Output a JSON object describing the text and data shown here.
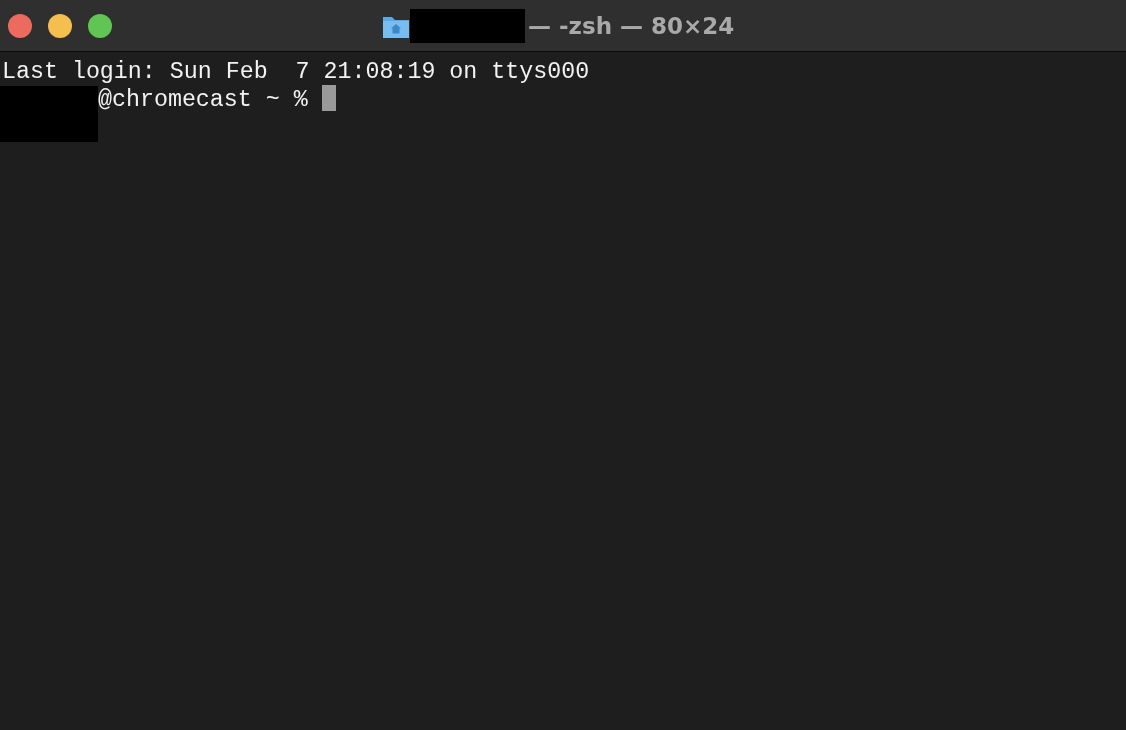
{
  "window": {
    "title": "— -zsh — 80×24"
  },
  "terminal": {
    "lines": [
      "Last login: Sun Feb  7 21:08:19 on ttys000"
    ],
    "prompt": "@chromecast ~ %"
  }
}
